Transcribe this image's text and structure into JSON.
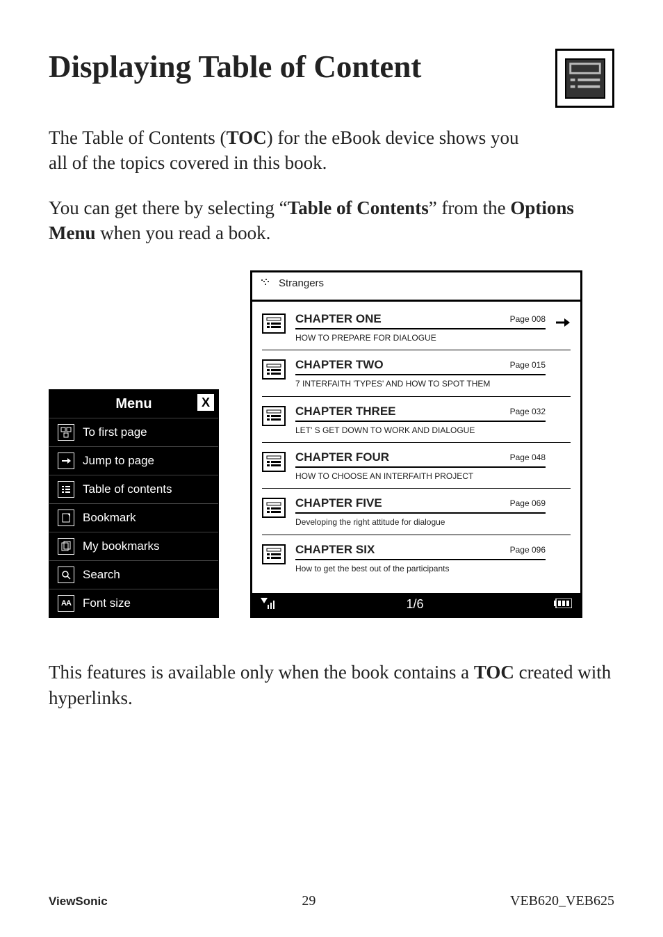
{
  "header": {
    "title": "Displaying Table of Content"
  },
  "intro": {
    "p1_pre": "The Table of Contents (",
    "p1_bold": "TOC",
    "p1_post": ") for the eBook device shows you all of the topics covered in this book.",
    "p2_pre": "You can get there by selecting “",
    "p2_bold": "Table of Contents",
    "p2_mid": "” from the ",
    "p2_bold2": "Options Menu",
    "p2_post": " when you read a book."
  },
  "menu": {
    "title": "Menu",
    "close": "X",
    "items": [
      {
        "label": "To first page"
      },
      {
        "label": "Jump to page"
      },
      {
        "label": "Table of contents"
      },
      {
        "label": "Bookmark"
      },
      {
        "label": "My bookmarks"
      },
      {
        "label": "Search"
      },
      {
        "label": "Font size"
      }
    ]
  },
  "toc": {
    "book_title": "Strangers",
    "chapters": [
      {
        "title": "CHAPTER ONE",
        "page": "Page 008",
        "subtitle": "HOW TO PREPARE FOR DIALOGUE",
        "arrow": true
      },
      {
        "title": "CHAPTER TWO",
        "page": "Page 015",
        "subtitle": "7 INTERFAITH 'TYPES' AND HOW TO SPOT THEM",
        "arrow": false
      },
      {
        "title": "CHAPTER THREE",
        "page": "Page 032",
        "subtitle": "LET' S GET DOWN TO WORK AND DIALOGUE",
        "arrow": false
      },
      {
        "title": "CHAPTER FOUR",
        "page": "Page 048",
        "subtitle": "HOW TO CHOOSE AN INTERFAITH PROJECT",
        "arrow": false
      },
      {
        "title": "CHAPTER FIVE",
        "page": "Page 069",
        "subtitle": "Developing the right attitude for dialogue",
        "arrow": false
      },
      {
        "title": "CHAPTER SIX",
        "page": "Page 096",
        "subtitle": "How to get the best out of the participants",
        "arrow": false
      }
    ],
    "pager": "1/6"
  },
  "outro": {
    "pre": "This features is available only when the book contains a ",
    "bold": "TOC",
    "post": " created with hyperlinks."
  },
  "footer": {
    "left": "ViewSonic",
    "mid": "29",
    "right": "VEB620_VEB625"
  }
}
